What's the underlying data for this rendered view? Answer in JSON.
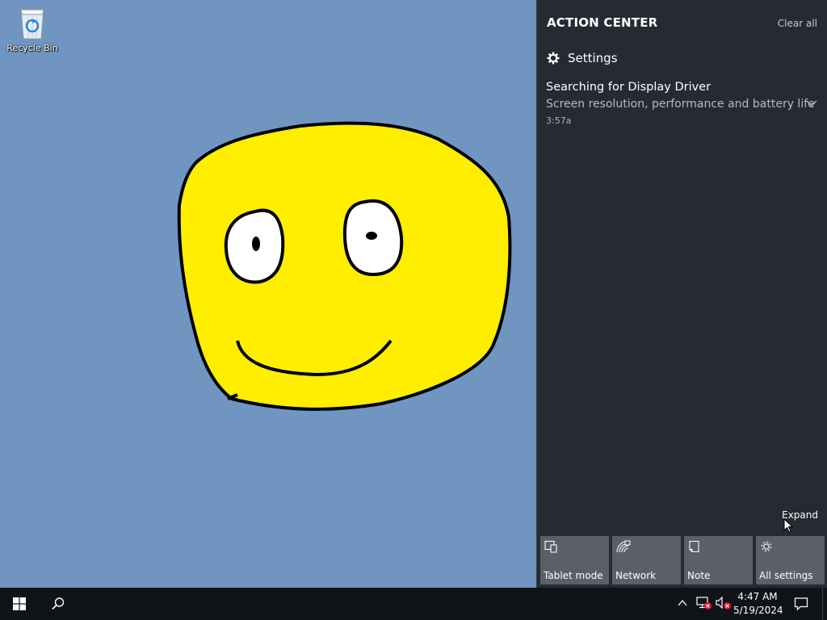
{
  "desktop": {
    "icons": [
      {
        "label": "Recycle Bin",
        "icon": "recycle-bin-icon"
      }
    ],
    "wallpaper_color": "#6f95c0",
    "drawing": {
      "face_color": "#ffee00",
      "outline_color": "#000000"
    }
  },
  "action_center": {
    "title": "ACTION CENTER",
    "clear_all": "Clear all",
    "group": {
      "name": "Settings",
      "icon": "gear-icon"
    },
    "notification": {
      "title": "Searching for Display Driver",
      "body": "Screen resolution, performance and battery life",
      "time": "3:57a"
    },
    "expand_label": "Expand",
    "quick_actions": [
      {
        "label": "Tablet mode",
        "icon": "tablet-mode-icon"
      },
      {
        "label": "Network",
        "icon": "network-icon"
      },
      {
        "label": "Note",
        "icon": "note-icon"
      },
      {
        "label": "All settings",
        "icon": "gear-icon"
      }
    ],
    "background_color": "#252a33",
    "tile_color": "#5a5f68"
  },
  "taskbar": {
    "clock": {
      "time": "4:47 AM",
      "date": "5/19/2024"
    },
    "background_color": "#101318"
  }
}
